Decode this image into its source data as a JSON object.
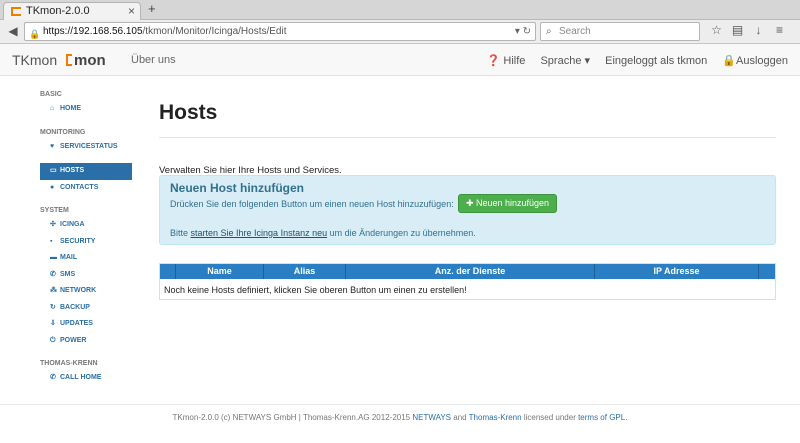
{
  "browser": {
    "tab_title": "TKmon-2.0.0",
    "newtab_icon": "+",
    "url_host": "https://192.168.56.105",
    "url_path": "/tkmon/Monitor/Icinga/Hosts/Edit",
    "search_placeholder": "Search"
  },
  "header": {
    "brand": "TKmon",
    "logo": "mon",
    "about": "Über uns",
    "help": "Hilfe",
    "language": "Sprache",
    "logged_in": "Eingeloggt als tkmon",
    "logout": "Ausloggen"
  },
  "sidebar": {
    "sections": {
      "basic": "BASIC",
      "monitoring": "MONITORING",
      "system": "SYSTEM",
      "thomas_krenn": "THOMAS-KRENN"
    },
    "items": {
      "home": "HOME",
      "servicestatus": "SERVICESTATUS",
      "hosts": "HOSTS",
      "contacts": "CONTACTS",
      "icinga": "ICINGA",
      "security": "SECURITY",
      "mail": "MAIL",
      "sms": "SMS",
      "network": "NETWORK",
      "backup": "BACKUP",
      "updates": "UPDATES",
      "power": "POWER",
      "call_home": "CALL HOME"
    }
  },
  "main": {
    "title": "Hosts",
    "intro": "Verwalten Sie hier Ihre Hosts und Services.",
    "info_title": "Neuen Host hinzufügen",
    "info_text": "Drücken Sie den folgenden Button um einen neuen Host hinzuzufügen:",
    "add_button": "Neuen hinzufügen",
    "restart_prefix": "Bitte ",
    "restart_link": "starten Sie Ihre Icinga Instanz neu",
    "restart_suffix": " um die Änderungen zu übernehmen.",
    "table": {
      "headers": [
        "",
        "Name",
        "Alias",
        "Anz. der Dienste",
        "IP Adresse",
        ""
      ],
      "empty": "Noch keine Hosts definiert, klicken Sie oberen Button um einen zu erstellen!"
    }
  },
  "footer": {
    "text1": "TKmon-2.0.0 (c) NETWAYS GmbH | Thomas-Krenn.AG 2012-2015 ",
    "netways": "NETWAYS",
    "and": " and ",
    "tk": "Thomas-Krenn",
    "licensed": " licensed under ",
    "gpl": "terms of GPL",
    "end": "."
  },
  "colors": {
    "accent": "#2a6fa8",
    "logo_orange": "#f07d00",
    "success": "#4caf4c",
    "info_bg": "#d9edf7"
  }
}
